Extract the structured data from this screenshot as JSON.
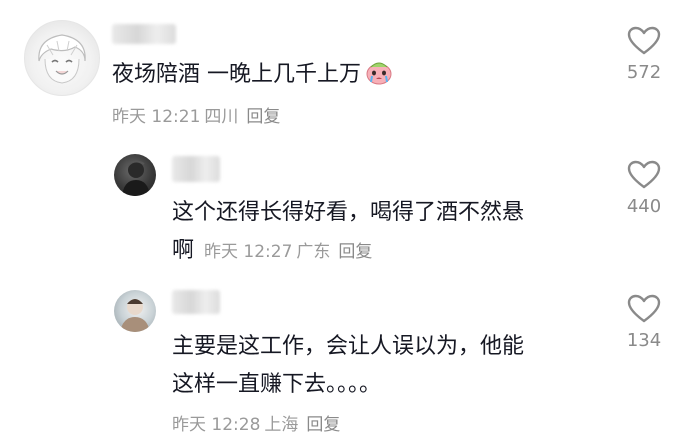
{
  "comments": [
    {
      "text": "夜场陪酒 一晚上几千上万",
      "emoji": "crying-face-emoji",
      "time": "昨天 12:21",
      "location": "四川",
      "reply_label": "回复",
      "likes": "572"
    },
    {
      "text_line1": "这个还得长得好看，喝得了酒不然悬",
      "text_line2": "啊",
      "time": "昨天 12:27",
      "location": "广东",
      "reply_label": "回复",
      "likes": "440"
    },
    {
      "text_line1": "主要是这工作，会让人误以为，他能",
      "text_line2": "这样一直赚下去。。。。",
      "time": "昨天 12:28",
      "location": "上海",
      "reply_label": "回复",
      "likes": "134"
    }
  ],
  "colors": {
    "text": "#161823",
    "meta": "#9a9a9a",
    "heart_stroke": "#8a8a8a"
  },
  "icons": [
    "heart-outline-icon",
    "crying-face-emoji"
  ]
}
